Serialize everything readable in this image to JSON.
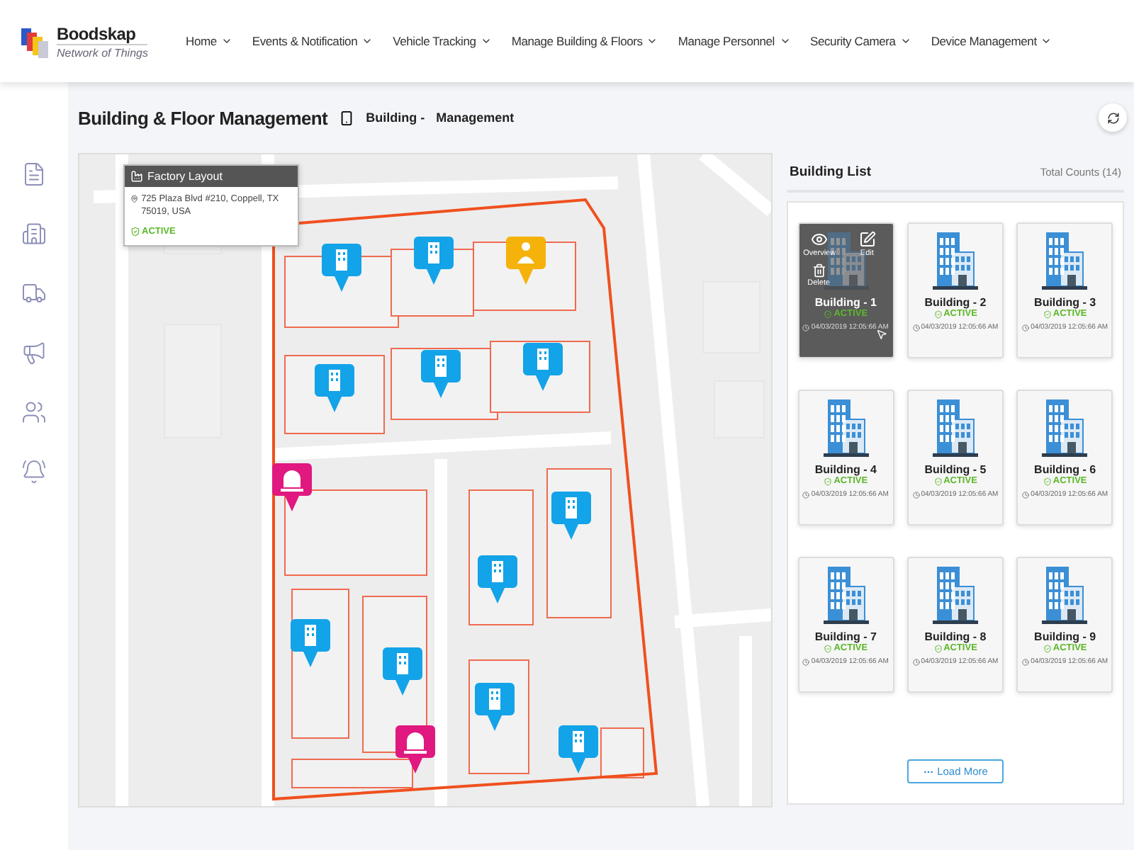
{
  "header": {
    "brand": "Boodskap",
    "tagline": "Network of Things",
    "nav": [
      {
        "label": "Home"
      },
      {
        "label": "Events & Notification"
      },
      {
        "label": "Vehicle Tracking"
      },
      {
        "label": "Manage Building & Floors"
      },
      {
        "label": "Manage Personnel"
      },
      {
        "label": "Security Camera"
      },
      {
        "label": "Device Management"
      }
    ]
  },
  "page": {
    "title": "Building & Floor Management",
    "crumbs": [
      "Building -",
      "Management"
    ]
  },
  "map": {
    "popup": {
      "title": "Factory Layout",
      "address": "725 Plaza Blvd #210, Coppell, TX 75019, USA",
      "status": "ACTIVE"
    }
  },
  "building_list": {
    "title": "Building List",
    "total": "Total Counts (14)",
    "actions": [
      "Overview",
      "Edit",
      "Delete"
    ],
    "buildings": [
      {
        "name": "Building - 1",
        "status": "ACTIVE",
        "time": "04/03/2019 12:05:66 AM",
        "hovered": true
      },
      {
        "name": "Building - 2",
        "status": "ACTIVE",
        "time": "04/03/2019 12:05:66 AM",
        "hovered": false
      },
      {
        "name": "Building - 3",
        "status": "ACTIVE",
        "time": "04/03/2019 12:05:66 AM",
        "hovered": false
      },
      {
        "name": "Building - 4",
        "status": "ACTIVE",
        "time": "04/03/2019 12:05:66 AM",
        "hovered": false
      },
      {
        "name": "Building - 5",
        "status": "ACTIVE",
        "time": "04/03/2019 12:05:66 AM",
        "hovered": false
      },
      {
        "name": "Building - 6",
        "status": "ACTIVE",
        "time": "04/03/2019 12:05:66 AM",
        "hovered": false
      },
      {
        "name": "Building - 7",
        "status": "ACTIVE",
        "time": "04/03/2019 12:05:66 AM",
        "hovered": false
      },
      {
        "name": "Building - 8",
        "status": "ACTIVE",
        "time": "04/03/2019 12:05:66 AM",
        "hovered": false
      },
      {
        "name": "Building - 9",
        "status": "ACTIVE",
        "time": "04/03/2019 12:05:66 AM",
        "hovered": false
      }
    ],
    "load_more": "Load More"
  }
}
